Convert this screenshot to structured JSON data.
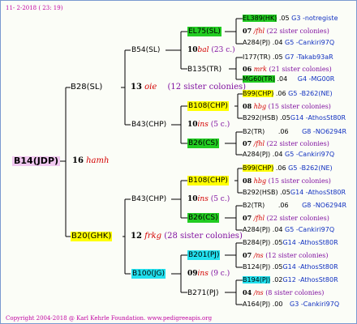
{
  "header": "11- 2-2018 ( 23: 19)",
  "footer": "Copyright 2004-2018 @ Karl Kehrle Foundation.   www.pedigreeapis.org",
  "root": {
    "label": "B14(JDP)",
    "gen_num": "16",
    "gen_name": "hamh"
  },
  "gen2": [
    {
      "label": "B28(SL)",
      "num": "13",
      "name": "oie",
      "sis": "(12 sister colonies)"
    },
    {
      "label": "B20(GHK)",
      "num": "12",
      "name": "frkg",
      "sis": "(28 sister colonies)"
    }
  ],
  "gen3": [
    {
      "label": "B54(SL)",
      "num": "10",
      "name": "bal",
      "sis": "(23 c.)"
    },
    {
      "label": "B135(TR)"
    },
    {
      "label": "B43(CHP)",
      "num": "10",
      "name": "ins",
      "sis": "(5 c.)"
    },
    {
      "label": "B43(CHP)",
      "num": "10",
      "name": "ins",
      "sis": "(5 c.)"
    },
    {
      "label": "B100(JG)",
      "num": "09",
      "name": "ins",
      "sis": "(9 c.)"
    },
    {
      "label": "B271(PJ)"
    }
  ],
  "gen4": [
    {
      "label": "EL75(SL)"
    },
    {
      "label": "B108(CHP)"
    },
    {
      "label": "B26(CS)"
    },
    {
      "label": "B108(CHP)"
    },
    {
      "label": "B26(CS)"
    },
    {
      "label": "B201(PJ)"
    }
  ],
  "gen5": [
    {
      "label": "EL389(HK)",
      "yr": ".05",
      "owner": "G3 -notregiste"
    },
    {
      "num": "07",
      "name": "/fhl",
      "sis": "(22 sister colonies)"
    },
    {
      "label": "A284(PJ)",
      "yr": ".04",
      "owner": "G5 -Cankiri97Q"
    },
    {
      "label": "I177(TR)",
      "yr": ".05",
      "owner": "G7 -Takab93aR"
    },
    {
      "num": "06",
      "name": "mrk",
      "sis": "(21 sister colonies)"
    },
    {
      "label": "MG60(TR)",
      "yr": ".04",
      "owner": "G4 -MG00R"
    },
    {
      "label": "B99(CHP)",
      "yr": ".06",
      "owner": "G5 -B262(NE)"
    },
    {
      "num": "08",
      "name": "hbg",
      "sis": "(15 sister colonies)"
    },
    {
      "label": "B292(HSB)",
      "yr": ".05",
      "owner": "G14 -AthosSt80R"
    },
    {
      "label": "B2(TR)",
      "yr": ".06",
      "owner": "G8 -NO6294R"
    },
    {
      "num": "07",
      "name": "/fhl",
      "sis": "(22 sister colonies)"
    },
    {
      "label": "A284(PJ)",
      "yr": ".04",
      "owner": "G5 -Cankiri97Q"
    },
    {
      "label": "B99(CHP)",
      "yr": ".06",
      "owner": "G5 -B262(NE)"
    },
    {
      "num": "08",
      "name": "hbg",
      "sis": "(15 sister colonies)"
    },
    {
      "label": "B292(HSB)",
      "yr": ".05",
      "owner": "G14 -AthosSt80R"
    },
    {
      "label": "B2(TR)",
      "yr": ".06",
      "owner": "G8 -NO6294R"
    },
    {
      "num": "07",
      "name": "/fhl",
      "sis": "(22 sister colonies)"
    },
    {
      "label": "A284(PJ)",
      "yr": ".04",
      "owner": "G5 -Cankiri97Q"
    },
    {
      "label": "B284(PJ)",
      "yr": ".05",
      "owner": "G14 -AthosSt80R"
    },
    {
      "num": "07",
      "name": "/ns",
      "sis": "(12 sister colonies)"
    },
    {
      "label": "B124(PJ)",
      "yr": ".05",
      "owner": "G14 -AthosSt80R"
    },
    {
      "label": "B194(PJ)",
      "yr": ".02",
      "owner": "G12 -AthosSt80R"
    },
    {
      "num": "04",
      "name": "/ns",
      "sis": "(8 sister colonies)"
    },
    {
      "label": "A164(PJ)",
      "yr": ".00",
      "owner": "G3 -Cankiri97Q"
    }
  ],
  "colors": {
    "yellow": "#ffff00",
    "green": "#22cc22",
    "cyan": "#22e0ee",
    "pink": "#f0c8f0",
    "accent": "#c000a0",
    "red": "#d40000",
    "blue": "#1030c0"
  }
}
